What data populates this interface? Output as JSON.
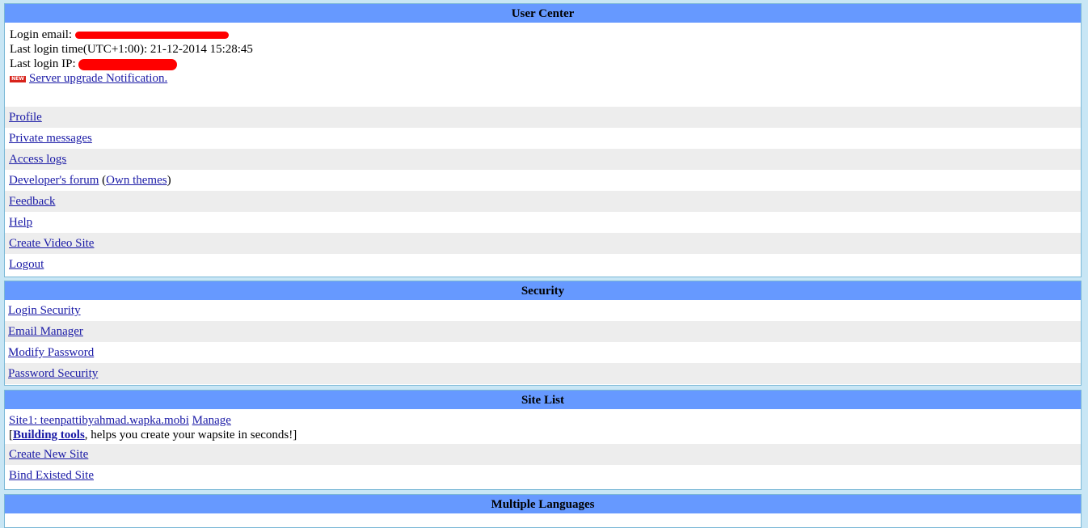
{
  "user_center": {
    "title": "User Center",
    "login_email_label": "Login email:",
    "last_login_time_label": "Last login time(UTC+1:00):",
    "last_login_time": "21-12-2014 15:28:45",
    "last_login_ip_label": "Last login IP:",
    "new_badge": "NEW",
    "notification_link": "Server upgrade Notification.",
    "links": {
      "profile": "Profile",
      "private_messages": "Private messages",
      "access_logs": "Access logs",
      "developers_forum": "Developer's forum",
      "own_themes": "Own themes",
      "feedback": "Feedback",
      "help": "Help",
      "create_video_site": "Create Video Site",
      "logout": "Logout"
    }
  },
  "security": {
    "title": "Security",
    "links": {
      "login_security": "Login Security",
      "email_manager": "Email Manager",
      "modify_password": "Modify Password",
      "password_security": "Password Security"
    }
  },
  "site_list": {
    "title": "Site List",
    "site1_link": "Site1: teenpattibyahmad.wapka.mobi",
    "manage_link": "Manage",
    "building_tools_link": "Building tools",
    "building_tools_suffix": ", helps you create your wapsite in seconds!]",
    "create_new_site": "Create New Site",
    "bind_existed_site": "Bind Existed Site"
  },
  "multiple_languages": {
    "title": "Multiple Languages"
  }
}
